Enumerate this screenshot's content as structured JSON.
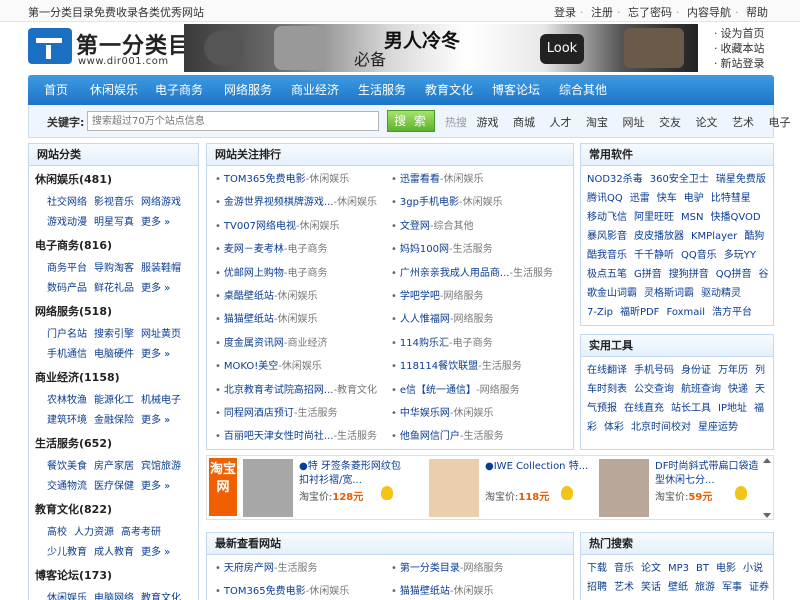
{
  "topbar": {
    "slogan": "第一分类目录免费收录各类优秀网站",
    "links": [
      "登录",
      "注册",
      "忘了密码",
      "内容导航",
      "帮助"
    ]
  },
  "logo": {
    "title": "第一分类目录",
    "url": "www.dir001.com"
  },
  "banner": {
    "text": "男人冷冬",
    "sub": "必备",
    "look": "Look"
  },
  "quick": [
    "设为首页",
    "收藏本站",
    "新站登录"
  ],
  "nav": [
    "首页",
    "休闲娱乐",
    "电子商务",
    "网络服务",
    "商业经济",
    "生活服务",
    "教育文化",
    "博客论坛",
    "综合其他"
  ],
  "search": {
    "label": "关键字:",
    "placeholder": "搜索超过70万个站点信息",
    "button": "搜 索",
    "hot_label": "热搜",
    "hot": [
      "游戏",
      "商城",
      "人才",
      "淘宝",
      "网址",
      "交友",
      "论文",
      "艺术",
      "电子",
      "礼品"
    ]
  },
  "left": {
    "title": "网站分类",
    "cats": [
      {
        "name": "休闲娱乐(481)",
        "rows": [
          [
            "社交网络",
            "影视音乐",
            "网络游戏"
          ],
          [
            "游戏动漫",
            "明星写真",
            "更多 »"
          ]
        ]
      },
      {
        "name": "电子商务(816)",
        "rows": [
          [
            "商务平台",
            "导购淘客",
            "服装鞋帽"
          ],
          [
            "数码产品",
            "鲜花礼品",
            "更多 »"
          ]
        ]
      },
      {
        "name": "网络服务(518)",
        "rows": [
          [
            "门户名站",
            "搜索引擎",
            "网址黄页"
          ],
          [
            "手机通信",
            "电脑硬件",
            "更多 »"
          ]
        ]
      },
      {
        "name": "商业经济(1158)",
        "rows": [
          [
            "农林牧渔",
            "能源化工",
            "机械电子"
          ],
          [
            "建筑环境",
            "金融保险",
            "更多 »"
          ]
        ]
      },
      {
        "name": "生活服务(652)",
        "rows": [
          [
            "餐饮美食",
            "房产家居",
            "宾馆旅游"
          ],
          [
            "交通物流",
            "医疗保健",
            "更多 »"
          ]
        ]
      },
      {
        "name": "教育文化(822)",
        "rows": [
          [
            "高校",
            "人力资源",
            "高考考研"
          ],
          [
            "少儿教育",
            "成人教育",
            "更多 »"
          ]
        ]
      },
      {
        "name": "博客论坛(173)",
        "rows": [
          [
            "休闲娱乐",
            "电脑网络",
            "教育文化"
          ]
        ]
      }
    ]
  },
  "rank": {
    "title": "网站关注排行",
    "left": [
      {
        "name": "TOM365免费电影",
        "tag": "-休闲娱乐"
      },
      {
        "name": "金游世界视频棋牌游戏...",
        "tag": "-休闲娱乐"
      },
      {
        "name": "TV007网络电视",
        "tag": "-休闲娱乐"
      },
      {
        "name": "麦网－麦考林",
        "tag": "-电子商务"
      },
      {
        "name": "优邮网上购物",
        "tag": "-电子商务"
      },
      {
        "name": "桌酷壁纸站",
        "tag": "-休闲娱乐"
      },
      {
        "name": "猫猫壁纸站",
        "tag": "-休闲娱乐"
      },
      {
        "name": "度金属资讯网",
        "tag": "-商业经济"
      },
      {
        "name": "MOKO!美空",
        "tag": "-休闲娱乐"
      },
      {
        "name": "北京教育考试院高招网...",
        "tag": "-教育文化"
      },
      {
        "name": "同程网酒店预订",
        "tag": "-生活服务"
      },
      {
        "name": "百丽吧天津女性时尚社...",
        "tag": "-生活服务"
      }
    ],
    "right": [
      {
        "name": "迅雷看看",
        "tag": "-休闲娱乐"
      },
      {
        "name": "3gp手机电影",
        "tag": "-休闲娱乐"
      },
      {
        "name": "文登网",
        "tag": "-综合其他"
      },
      {
        "name": "妈妈100网",
        "tag": "-生活服务"
      },
      {
        "name": "广州亲亲我成人用品商...",
        "tag": "-生活服务"
      },
      {
        "name": "学吧学吧",
        "tag": "-网络服务"
      },
      {
        "name": "人人惟福网",
        "tag": "-网络服务"
      },
      {
        "name": "114购乐汇",
        "tag": "-电子商务"
      },
      {
        "name": "118114餐饮联盟",
        "tag": "-生活服务"
      },
      {
        "name": "e信【统一通信】",
        "tag": "-网络服务"
      },
      {
        "name": "中华娱乐网",
        "tag": "-休闲娱乐"
      },
      {
        "name": "他鱼网信门户",
        "tag": "-生活服务"
      }
    ]
  },
  "software": {
    "title": "常用软件",
    "rows": [
      [
        "NOD32杀毒",
        "360安全卫士",
        "瑞星免费版"
      ],
      [
        "腾讯QQ",
        "迅雷",
        "快车",
        "电驴",
        "比特彗星"
      ],
      [
        "移动飞信",
        "阿里旺旺",
        "MSN",
        "快播QVOD"
      ],
      [
        "暴风影音",
        "皮皮播放器",
        "KMPlayer",
        "酷狗"
      ],
      [
        "酷我音乐",
        "千千静听",
        "QQ音乐",
        "多玩YY"
      ],
      [
        "极点五笔",
        "G拼音",
        "搜狗拼音",
        "QQ拼音",
        "谷"
      ],
      [
        "歌金山词霸",
        "灵格斯词霸",
        "驱动精灵"
      ],
      [
        "7-Zip",
        "福昕PDF",
        "Foxmail",
        "浩方平台"
      ]
    ]
  },
  "tools": {
    "title": "实用工具",
    "rows": [
      [
        "在线翻译",
        "手机号码",
        "身份证",
        "万年历",
        "列"
      ],
      [
        "车时刻表",
        "公交查询",
        "航班查询",
        "快递",
        "天"
      ],
      [
        "气预报",
        "在线直充",
        "站长工具",
        "IP地址",
        "福"
      ],
      [
        "彩",
        "体彩",
        "北京时间校对",
        "星座运势"
      ]
    ]
  },
  "ads": {
    "taobao": "淘宝网",
    "items": [
      {
        "title": "●特 牙签条菱形网纹包扣衬衫褶/宽...",
        "price_label": "淘宝价:",
        "price": "128元"
      },
      {
        "title": "●IWE Collection 特...",
        "price_label": "淘宝价:",
        "price": "118元"
      },
      {
        "title": "DF时尚斜式带扁口袋造型休闲七分...",
        "price_label": "淘宝价:",
        "price": "59元"
      }
    ]
  },
  "latest": {
    "title": "最新查看网站",
    "items": [
      {
        "name": "天府房产网",
        "tag": "-生活服务"
      },
      {
        "name": "第一分类目录",
        "tag": "-网络服务"
      },
      {
        "name": "TOM365免费电影",
        "tag": "-休闲娱乐"
      },
      {
        "name": "猫猫壁纸站",
        "tag": "-休闲娱乐"
      }
    ]
  },
  "hotsearch": {
    "title": "热门搜索",
    "rows": [
      [
        "下载",
        "音乐",
        "论文",
        "MP3",
        "BT",
        "电影",
        "小说"
      ],
      [
        "招聘",
        "艺术",
        "笑话",
        "壁纸",
        "旅游",
        "军事",
        "证券"
      ]
    ]
  },
  "colors": {
    "nav": "#1b74c6",
    "accent": "#f06000",
    "search_btn": "#5db12b"
  }
}
